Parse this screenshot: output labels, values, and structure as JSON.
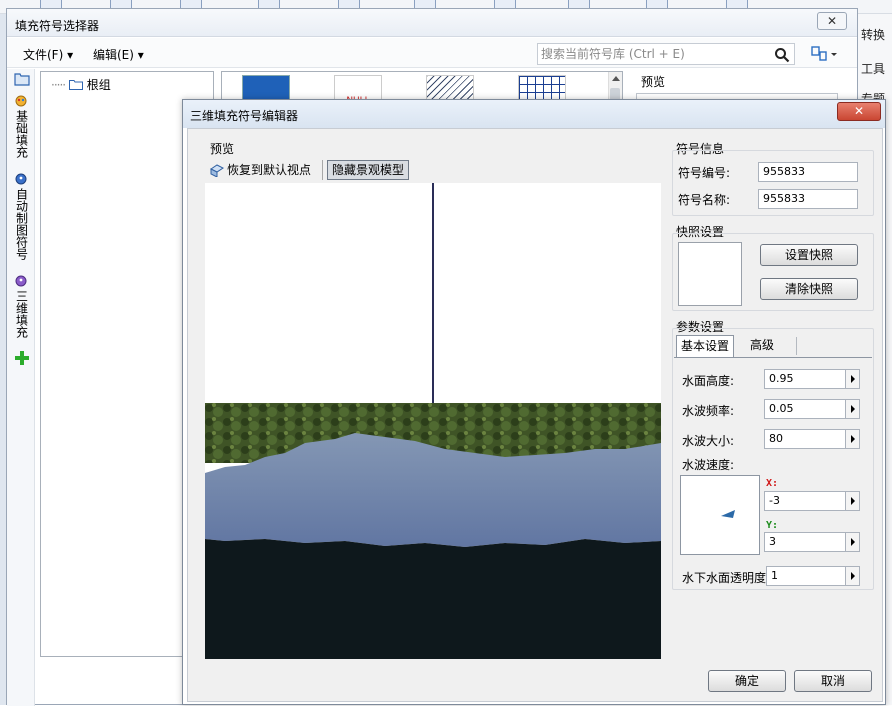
{
  "background_app": {
    "right_labels": [
      "转换",
      "工具",
      "专题"
    ]
  },
  "selector_window": {
    "title": "填充符号选择器",
    "close_glyph": "✕",
    "menu": {
      "file": "文件(F)",
      "edit": "编辑(E)"
    },
    "search": {
      "placeholder": "搜索当前符号库 (Ctrl + E)"
    },
    "side_tabs": [
      "基础填充",
      "自动制图符号",
      "三维填充"
    ],
    "tree": {
      "root": "根组"
    },
    "thumbnails": [
      "",
      "NULL",
      "",
      ""
    ],
    "preview_label": "预览"
  },
  "editor": {
    "title": "三维填充符号编辑器",
    "close_glyph": "✕",
    "preview": {
      "label": "预览",
      "reset_view": "恢复到默认视点",
      "hide_model": "隐藏景观模型"
    },
    "symbol_info": {
      "title": "符号信息",
      "id_label": "符号编号:",
      "id_value": "955833",
      "name_label": "符号名称:",
      "name_value": "955833"
    },
    "snapshot": {
      "title": "快照设置",
      "set_button": "设置快照",
      "clear_button": "清除快照"
    },
    "params": {
      "title": "参数设置",
      "tabs": [
        "基本设置",
        "高级"
      ],
      "water_height_label": "水面高度:",
      "water_height": "0.95",
      "wave_freq_label": "水波频率:",
      "wave_freq": "0.05",
      "wave_size_label": "水波大小:",
      "wave_size": "80",
      "wave_speed_label": "水波速度:",
      "x_label": "X:",
      "x_value": "-3",
      "y_label": "Y:",
      "y_value": "3",
      "under_alpha_label": "水下水面透明度",
      "under_alpha": "1"
    },
    "ok_button": "确定",
    "cancel_button": "取消"
  }
}
